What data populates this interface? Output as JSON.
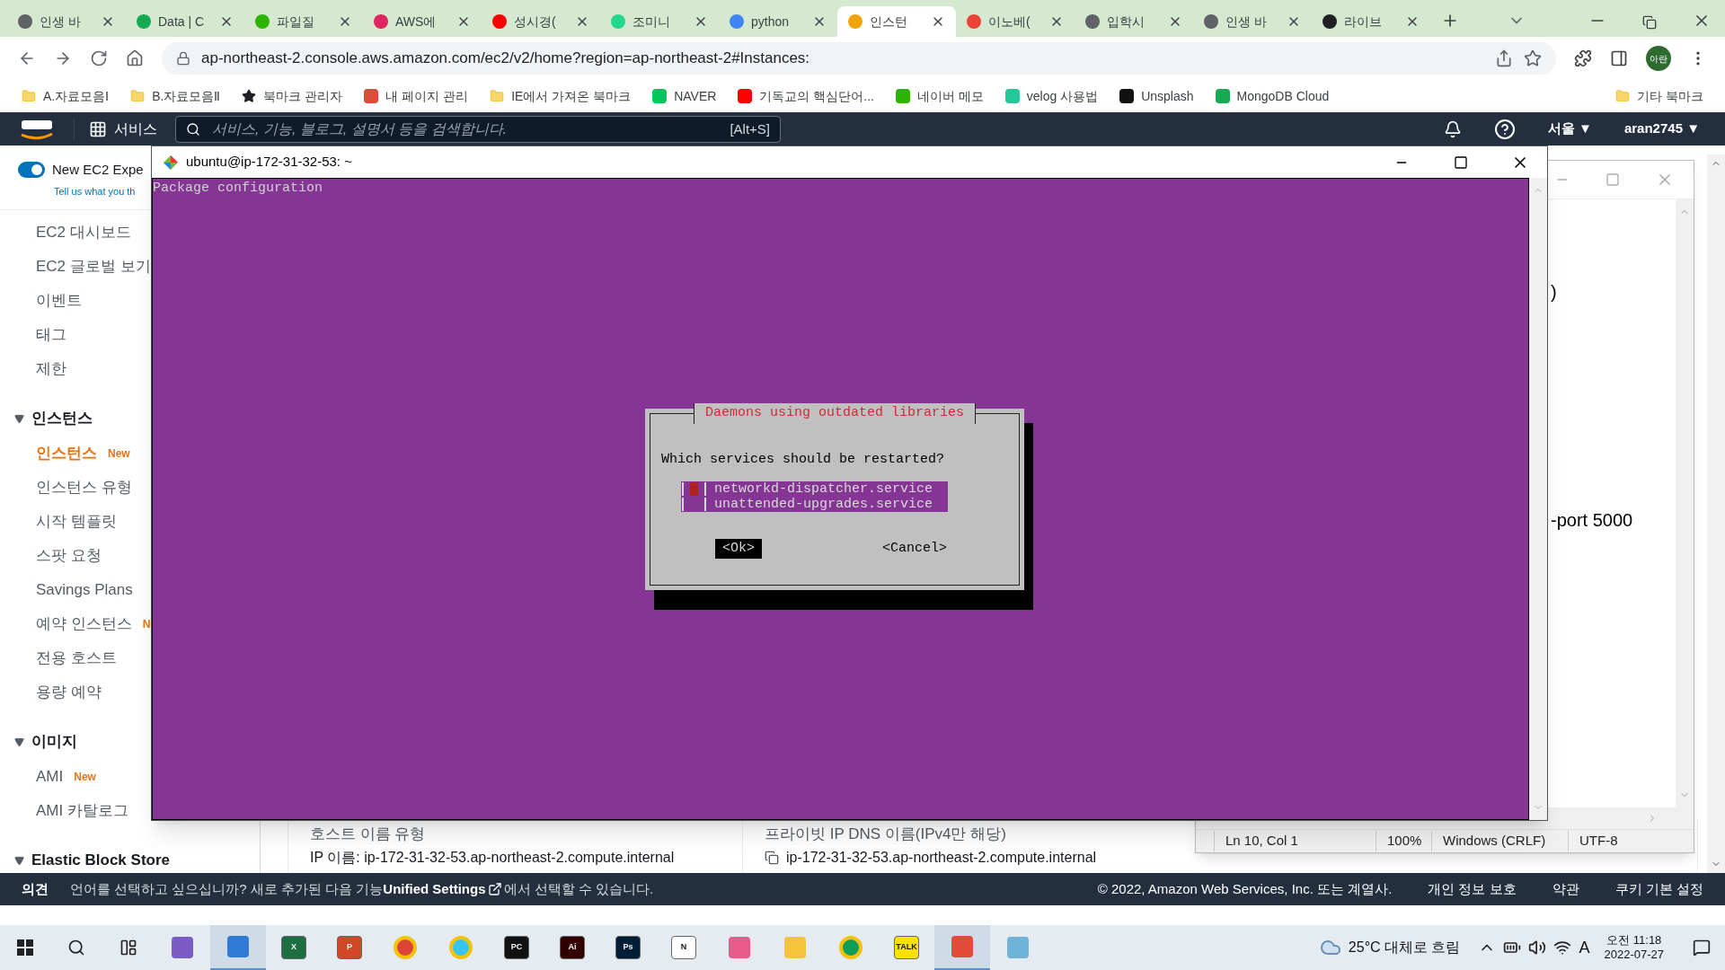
{
  "browser": {
    "tabs": [
      {
        "title": "인생 바",
        "color": "#5f6368",
        "selected": false
      },
      {
        "title": "Data | C",
        "color": "#13aa52",
        "selected": false
      },
      {
        "title": "파일질",
        "color": "#2db400",
        "selected": false
      },
      {
        "title": "AWS에",
        "color": "#e0245e",
        "selected": false
      },
      {
        "title": "성시경(",
        "color": "#ff0000",
        "selected": false
      },
      {
        "title": "조미니",
        "color": "#21d789",
        "selected": false
      },
      {
        "title": "python",
        "color": "#4285f4",
        "selected": false
      },
      {
        "title": "인스턴",
        "color": "#f0a30a",
        "selected": true
      },
      {
        "title": "이노베(",
        "color": "#ea4335",
        "selected": false
      },
      {
        "title": "입학시",
        "color": "#5f6368",
        "selected": false
      },
      {
        "title": "인생 바",
        "color": "#5f6368",
        "selected": false
      },
      {
        "title": "라이브",
        "color": "#202124",
        "selected": false
      }
    ],
    "url": "ap-northeast-2.console.aws.amazon.com/ec2/v2/home?region=ap-northeast-2#Instances:",
    "profile": "아란",
    "bookmarks": [
      {
        "label": "A.자료모음Ⅰ",
        "kind": "folder"
      },
      {
        "label": "B.자료모음Ⅱ",
        "kind": "folder"
      },
      {
        "label": "북마크 관리자",
        "kind": "star"
      },
      {
        "label": "내 페이지 관리",
        "kind": "site",
        "color": "#dd4b39"
      },
      {
        "label": "IE에서 가져온 북마크",
        "kind": "folder"
      },
      {
        "label": "NAVER",
        "kind": "site",
        "color": "#03c75a"
      },
      {
        "label": "기독교의 핵심단어...",
        "kind": "site",
        "color": "#ff0000"
      },
      {
        "label": "네이버 메모",
        "kind": "site",
        "color": "#2db400"
      },
      {
        "label": "velog 사용법",
        "kind": "site",
        "color": "#20c997"
      },
      {
        "label": "Unsplash",
        "kind": "site",
        "color": "#111111"
      },
      {
        "label": "MongoDB Cloud",
        "kind": "site",
        "color": "#13aa52"
      }
    ],
    "other_bookmarks": "기타 북마크"
  },
  "console_header": {
    "services": "서비스",
    "search_placeholder": "서비스, 기능, 블로그, 설명서 등을 검색합니다.",
    "shortcut": "[Alt+S]",
    "region": "서울 ▼",
    "account": "aran2745 ▼"
  },
  "sidebar": {
    "toggle": {
      "label": "New EC2 Expe",
      "on": true
    },
    "feedback_link": "Tell us what you th",
    "groups": [
      {
        "items": [
          {
            "label": "EC2 대시보드",
            "selected": false
          },
          {
            "label": "EC2 글로벌 보기",
            "selected": false
          },
          {
            "label": "이벤트",
            "selected": false
          },
          {
            "label": "태그",
            "selected": false
          },
          {
            "label": "제한",
            "selected": false
          }
        ]
      },
      {
        "title": "인스턴스",
        "expanded": true,
        "items": [
          {
            "label": "인스턴스",
            "badge": "New",
            "selected": true
          },
          {
            "label": "인스턴스 유형",
            "selected": false
          },
          {
            "label": "시작 템플릿",
            "selected": false
          },
          {
            "label": "스팟 요청",
            "selected": false
          },
          {
            "label": "Savings Plans",
            "selected": false
          },
          {
            "label": "예약 인스턴스",
            "badge": "N",
            "selected": false
          },
          {
            "label": "전용 호스트",
            "selected": false
          },
          {
            "label": "용량 예약",
            "selected": false
          }
        ]
      },
      {
        "title": "이미지",
        "expanded": true,
        "items": [
          {
            "label": "AMI",
            "badge": "New",
            "selected": false
          },
          {
            "label": "AMI 카탈로그",
            "selected": false
          }
        ]
      },
      {
        "title": "Elastic Block Store",
        "expanded": true
      }
    ]
  },
  "details": [
    {
      "label": "호스트 이름 유형",
      "value": "IP 이름: ip-172-31-32-53.ap-northeast-2.compute.internal"
    },
    {
      "label": "프라이빗 IP DNS 이름(IPv4만 해당)",
      "value": "ip-172-31-32-53.ap-northeast-2.compute.internal"
    }
  ],
  "notepad": {
    "lines": [
      ")",
      "-port 5000"
    ],
    "status": [
      "Ln 10, Col 1",
      "100%",
      "Windows (CRLF)",
      "UTF-8"
    ]
  },
  "terminal": {
    "title": "ubuntu@ip-172-31-32-53: ~",
    "header": "Package configuration",
    "dialog": {
      "title": "Daemons using outdated libraries",
      "question": "Which services should be restarted?",
      "items": [
        {
          "label": "networkd-dispatcher.service",
          "checked": false,
          "selected": true
        },
        {
          "label": "unattended-upgrades.service",
          "checked": false,
          "selected": false
        }
      ],
      "buttons": [
        {
          "label": "<Ok>",
          "selected": true
        },
        {
          "label": "<Cancel>",
          "selected": false
        }
      ]
    }
  },
  "footer": {
    "feedback": "의견",
    "notice_before": "언어를 선택하고 싶으십니까? 새로 추가된 다음 기능",
    "notice_link": "Unified Settings",
    "notice_after": "에서 선택할 수 있습니다.",
    "copyright": "© 2022, Amazon Web Services, Inc. 또는 계열사.",
    "links": [
      "개인 정보 보호",
      "약관",
      "쿠키 기본 설정"
    ]
  },
  "taskbar": {
    "apps": [
      {
        "kind": "shape",
        "color": "#7b5cc5",
        "active": false
      },
      {
        "kind": "shape",
        "color": "#2f7bd6",
        "active": true
      },
      {
        "kind": "letter",
        "label": "X",
        "color": "#1d6f42",
        "active": false
      },
      {
        "kind": "letter",
        "label": "P",
        "color": "#d24726",
        "active": false
      },
      {
        "kind": "round",
        "color": "#db4437",
        "active": false
      },
      {
        "kind": "round",
        "color": "#36c5f0",
        "active": false
      },
      {
        "kind": "letter",
        "label": "PC",
        "color": "#111111",
        "active": false
      },
      {
        "kind": "letter",
        "label": "Ai",
        "color": "#330000",
        "active": false
      },
      {
        "kind": "letter",
        "label": "Ps",
        "color": "#001e36",
        "active": false
      },
      {
        "kind": "letter",
        "label": "N",
        "color": "#ffffff",
        "active": false
      },
      {
        "kind": "shape",
        "color": "#e85a8a",
        "active": false
      },
      {
        "kind": "shape",
        "color": "#f3c33c",
        "active": false
      },
      {
        "kind": "round",
        "color": "#0f9d58",
        "active": false
      },
      {
        "kind": "letter",
        "label": "TALK",
        "color": "#fae100",
        "active": false
      },
      {
        "kind": "shape",
        "color": "#e24a3b",
        "active": true
      },
      {
        "kind": "shape",
        "color": "#6fb4d8",
        "active": false
      }
    ],
    "weather": "25°C 대체로 흐림",
    "ime": "A",
    "time": "오전 11:18",
    "date": "2022-07-27"
  }
}
